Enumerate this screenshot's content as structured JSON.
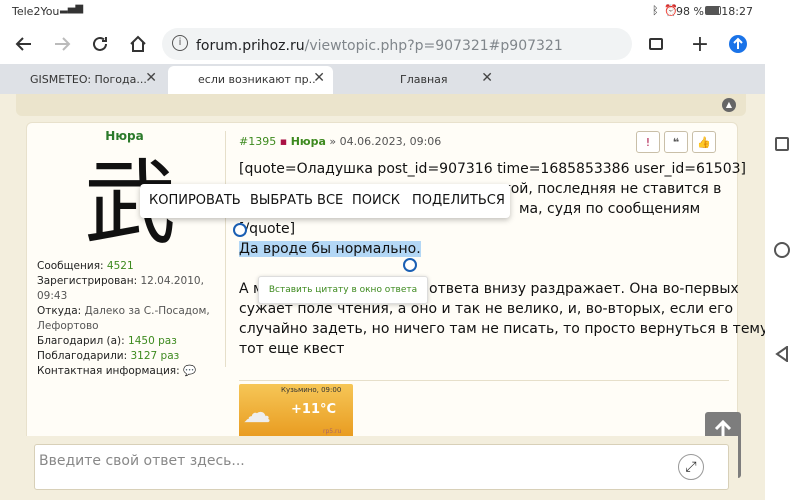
{
  "status": {
    "carrier": "Tele2You",
    "battery": "98 %",
    "time": "18:27"
  },
  "browser": {
    "url_host": "forum.prihoz.ru",
    "url_path": "/viewtopic.php?p=907321#p907321"
  },
  "tabs": [
    {
      "label": "GISMETEO: Погода..."
    },
    {
      "label": "если возникают пр..."
    },
    {
      "label": "Главная"
    }
  ],
  "author": {
    "name": "Нюра",
    "avatar_char": "武",
    "stats": [
      {
        "label": "Сообщения:",
        "value": "4521"
      },
      {
        "label": "Зарегистрирован:",
        "value": "12.04.2010, 09:43"
      },
      {
        "label": "Откуда:",
        "value": "Далеко за С.-Посадом, Лефортово"
      },
      {
        "label": "Благодарил (а):",
        "value": "1450 раз"
      },
      {
        "label": "Поблагодарили:",
        "value": "3127 раз"
      },
      {
        "label": "Контактная информация:",
        "value": ""
      }
    ]
  },
  "post": {
    "number": "#1395",
    "author": "Нюра",
    "sep": "»",
    "date": "04.06.2023, 09:06",
    "line1": "[quote=Оладушка post_id=907316 time=1685853386 user_id=61503]",
    "line2_end": "атой, последняя не ставится в",
    "line3_end": "ма, судя по сообщениям",
    "line4": "[/quote]",
    "line5": "Да вроде бы нормально.",
    "p2a_start": "А м",
    "p2a_end": "ответа внизу раздражает. Она во-первых",
    "p2b": "сужает поле чтения, а оно и так не велико, и, во-вторых, если его",
    "p2c": "случайно задеть, но ничего там не писать, то просто вернуться в тему",
    "p2d": "тот еще квест"
  },
  "weather": {
    "place": "Кузьмино, 09:00",
    "temp": "+11°C",
    "source": "rp5.ru"
  },
  "context_menu": {
    "copy": "КОПИРОВАТЬ",
    "select_all": "ВЫБРАТЬ ВСЕ",
    "search": "ПОИСК",
    "share": "ПОДЕЛИТЬСЯ"
  },
  "quote_tip": "Вставить цитату в окно ответа",
  "reply": {
    "placeholder": "Введите свой ответ здесь..."
  },
  "colors": {
    "accent": "#2b7a2b",
    "link": "#3d8a1f",
    "select": "#b3d7f5",
    "chrome_tab": "#dee1e6"
  }
}
